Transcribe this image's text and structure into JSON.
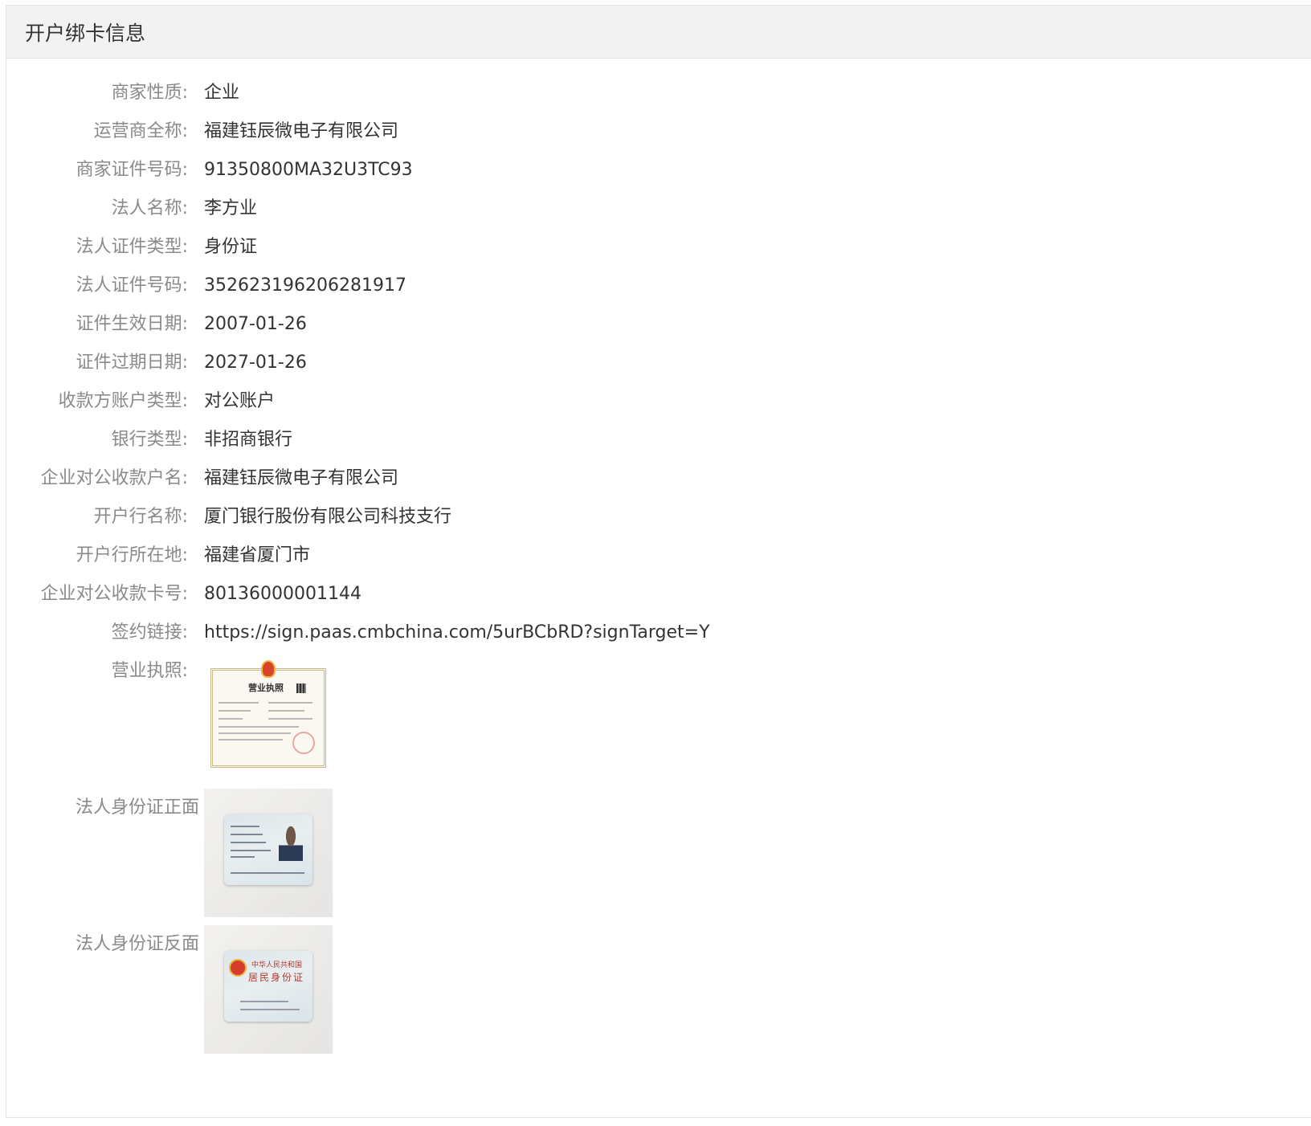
{
  "panel": {
    "title": "开户绑卡信息"
  },
  "fields": [
    {
      "label": "商家性质:",
      "value": "企业"
    },
    {
      "label": "运营商全称:",
      "value": "福建钰辰微电子有限公司"
    },
    {
      "label": "商家证件号码:",
      "value": "91350800MA32U3TC93"
    },
    {
      "label": "法人名称:",
      "value": "李方业"
    },
    {
      "label": "法人证件类型:",
      "value": "身份证"
    },
    {
      "label": "法人证件号码:",
      "value": "352623196206281917"
    },
    {
      "label": "证件生效日期:",
      "value": "2007-01-26"
    },
    {
      "label": "证件过期日期:",
      "value": "2027-01-26"
    },
    {
      "label": "收款方账户类型:",
      "value": "对公账户"
    },
    {
      "label": "银行类型:",
      "value": "非招商银行"
    },
    {
      "label": "企业对公收款户名:",
      "value": "福建钰辰微电子有限公司"
    },
    {
      "label": "开户行名称:",
      "value": "厦门银行股份有限公司科技支行"
    },
    {
      "label": "开户行所在地:",
      "value": "福建省厦门市"
    },
    {
      "label": "企业对公收款卡号:",
      "value": "80136000001144"
    },
    {
      "label": "签约链接:",
      "value": "https://sign.paas.cmbchina.com/5urBCbRD?signTarget=Y"
    }
  ],
  "images": {
    "license_label": "营业执照:",
    "license_title": "营业执照",
    "id_front_label": "法人身份证正面",
    "id_back_label": "法人身份证反面",
    "id_back_line1": "中华人民共和国",
    "id_back_line2": "居民身份证"
  }
}
